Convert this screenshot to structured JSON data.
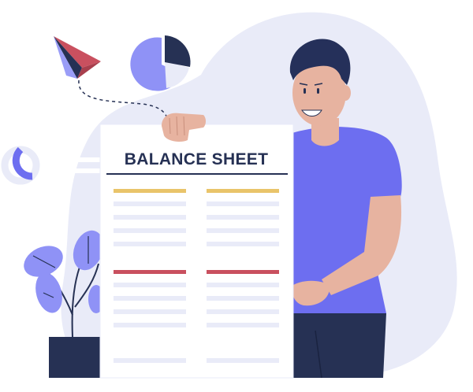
{
  "document": {
    "title": "BALANCE SHEET"
  },
  "colors": {
    "background_blob": "#e9ebf8",
    "accent_purple": "#6d6ef0",
    "pie_light": "#8f92f6",
    "navy": "#263154",
    "paper": "#ffffff",
    "line_gray": "#e4e6f5",
    "yellow_header": "#e9c46a",
    "red_header": "#c9505f",
    "skin": "#e7b3a0",
    "hair": "#25305a",
    "pot": "#263154",
    "leaf": "#8f92f6"
  },
  "icons": [
    "paper-plane-icon",
    "pie-chart-icon",
    "donut-chart-icon",
    "plant-icon"
  ]
}
